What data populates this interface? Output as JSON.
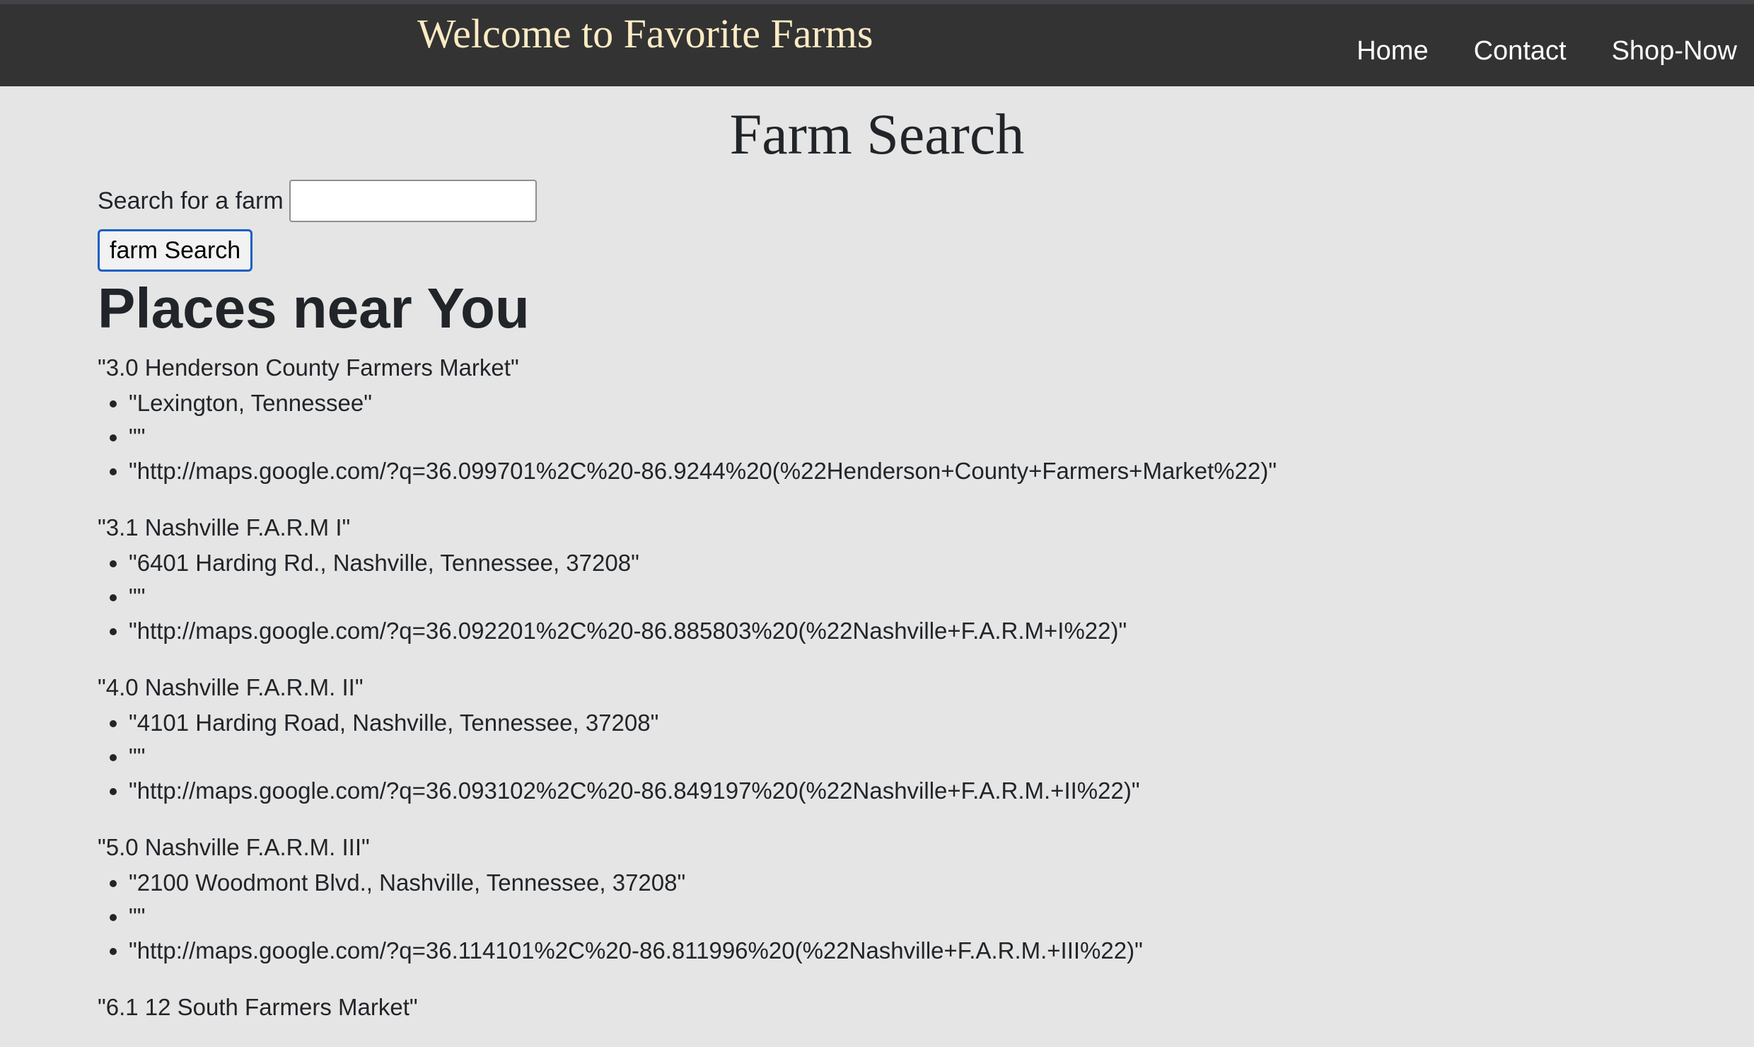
{
  "navbar": {
    "brand": "Welcome to Favorite Farms",
    "links": [
      "Home",
      "Contact",
      "Shop-Now"
    ]
  },
  "page": {
    "title": "Farm Search"
  },
  "search": {
    "label": "Search for a farm",
    "value": "",
    "placeholder": "",
    "button_label": "farm Search"
  },
  "places": {
    "heading": "Places near You",
    "items": [
      {
        "name": "\"3.0 Henderson County Farmers Market\"",
        "address": "\"Lexington, Tennessee\"",
        "note": "\"\"",
        "map": "\"http://maps.google.com/?q=36.099701%2C%20-86.9244%20(%22Henderson+County+Farmers+Market%22)\""
      },
      {
        "name": "\"3.1 Nashville F.A.R.M I\"",
        "address": "\"6401 Harding Rd., Nashville, Tennessee, 37208\"",
        "note": "\"\"",
        "map": "\"http://maps.google.com/?q=36.092201%2C%20-86.885803%20(%22Nashville+F.A.R.M+I%22)\""
      },
      {
        "name": "\"4.0 Nashville F.A.R.M. II\"",
        "address": "\"4101 Harding Road, Nashville, Tennessee, 37208\"",
        "note": "\"\"",
        "map": "\"http://maps.google.com/?q=36.093102%2C%20-86.849197%20(%22Nashville+F.A.R.M.+II%22)\""
      },
      {
        "name": "\"5.0 Nashville F.A.R.M. III\"",
        "address": "\"2100 Woodmont Blvd., Nashville, Tennessee, 37208\"",
        "note": "\"\"",
        "map": "\"http://maps.google.com/?q=36.114101%2C%20-86.811996%20(%22Nashville+F.A.R.M.+III%22)\""
      },
      {
        "name": "\"6.1 12 South Farmers Market\""
      }
    ]
  }
}
